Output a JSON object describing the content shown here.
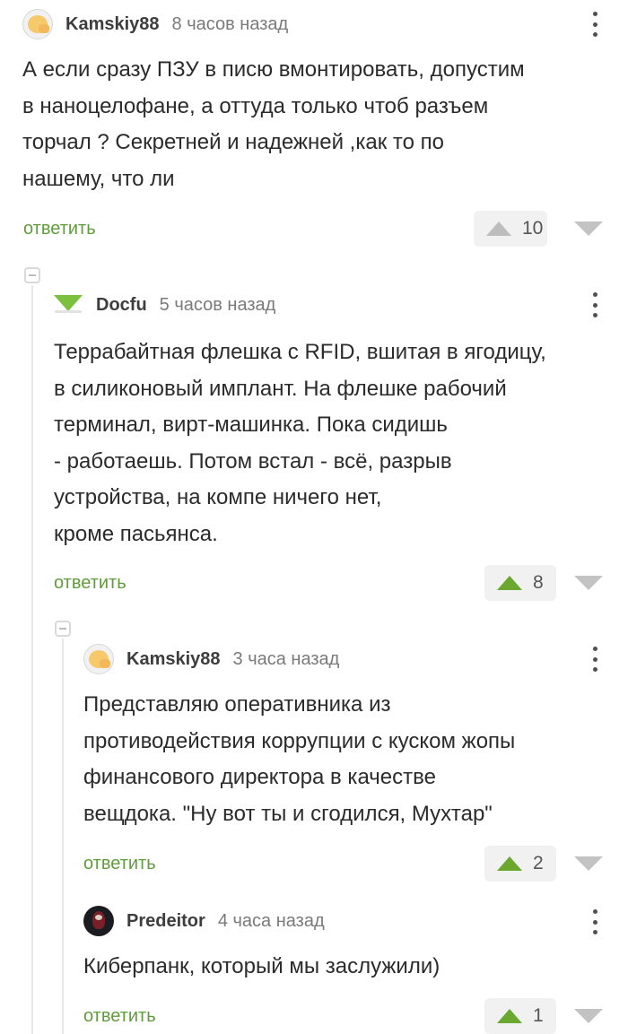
{
  "comments": [
    {
      "username": "Kamskiy88",
      "time": "8 часов назад",
      "avatar_icon": "emoji-face-icon",
      "text": "А если сразу ПЗУ в писю вмонтировать, допустим\nв наноцелофане, а оттуда только чтоб разъем\nторчал  ? Секретней и надежней ,как то по\nнашему, что ли",
      "reply_label": "ответить",
      "rating": "10",
      "upvoted": false
    },
    {
      "username": "Docfu",
      "time": "5 часов назад",
      "avatar_icon": "green-triangle-logo-icon",
      "text": "Террабайтная флешка с RFID, вшитая в ягодицу,\nв силиконовый имплант. На флешке рабочий\nтерминал, вирт-машинка. Пока сидишь\n- работаешь. Потом встал - всё, разрыв\nустройства, на компе ничего нет,\nкроме пасьянса.",
      "reply_label": "ответить",
      "rating": "8",
      "upvoted": true
    },
    {
      "username": "Kamskiy88",
      "time": "3 часа назад",
      "avatar_icon": "emoji-face-icon",
      "text": "Представляю оперативника из\nпротиводействия коррупции с куском жопы\nфинансового директора в качестве\nвещдока. \"Ну вот ты и сгодился, Мухтар\"",
      "reply_label": "ответить",
      "rating": "2",
      "upvoted": true
    },
    {
      "username": "Predeitor",
      "time": "4 часа назад",
      "avatar_icon": "dark-portrait-icon",
      "text": "Киберпанк, который мы заслужили)",
      "reply_label": "ответить",
      "rating": "1",
      "upvoted": true
    }
  ],
  "colors": {
    "accent_green": "#6aa82f",
    "reply_green": "#5f9c3c",
    "neutral_gray": "#bdbdbd"
  }
}
